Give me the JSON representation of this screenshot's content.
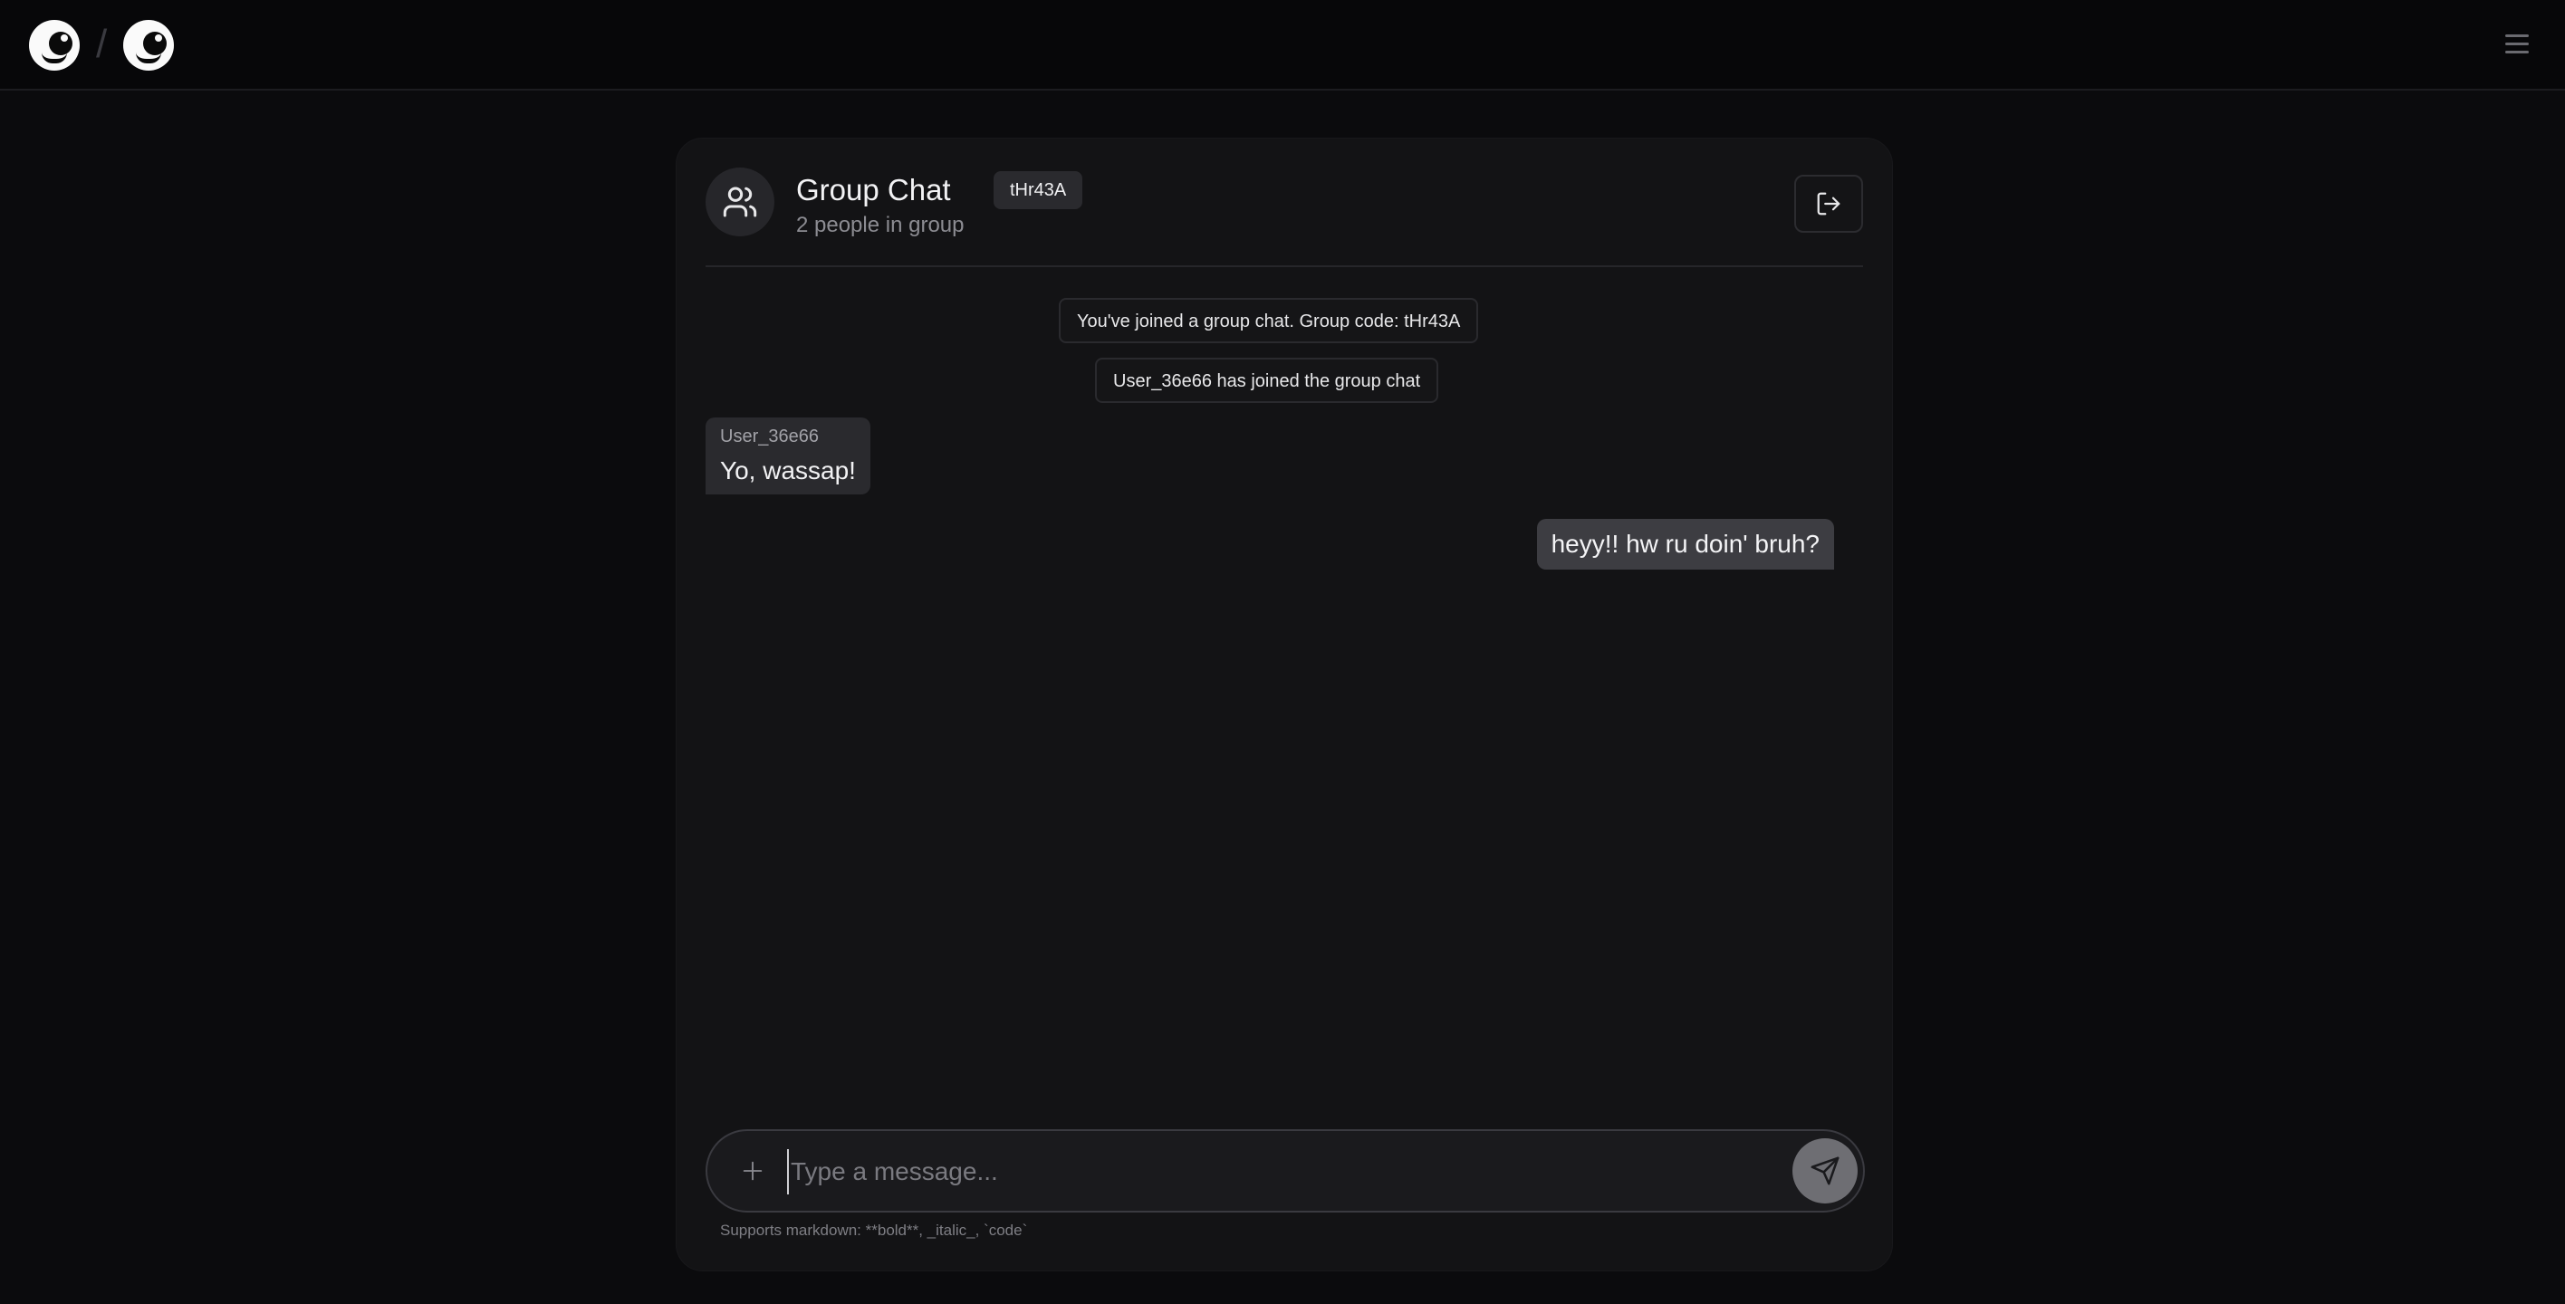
{
  "topbar": {
    "separator": "/",
    "logo_icon": "smiley-face-icon",
    "menu_icon": "hamburger-menu-icon"
  },
  "chat": {
    "title": "Group Chat",
    "group_code": "tHr43A",
    "member_count_text": "2 people in group",
    "avatar_icon": "users-icon",
    "leave_icon": "log-out-icon"
  },
  "messages": {
    "system": [
      "You've joined a group chat. Group code: tHr43A",
      "User_36e66 has joined the group chat"
    ],
    "incoming": {
      "sender": "User_36e66",
      "text": "Yo, wassap!"
    },
    "outgoing": {
      "text": "heyy!! hw ru doin' bruh?"
    }
  },
  "composer": {
    "placeholder": "Type a message...",
    "value": "",
    "attach_icon": "plus-icon",
    "send_icon": "send-icon",
    "hint": "Supports markdown: **bold**, _italic_, `code`"
  },
  "colors": {
    "background": "#0b0b0d",
    "card": "#131315",
    "outgoing_bubble": "#3d3d42",
    "incoming_bubble": "#2a2a2e",
    "send_button": "#6e6e73"
  }
}
